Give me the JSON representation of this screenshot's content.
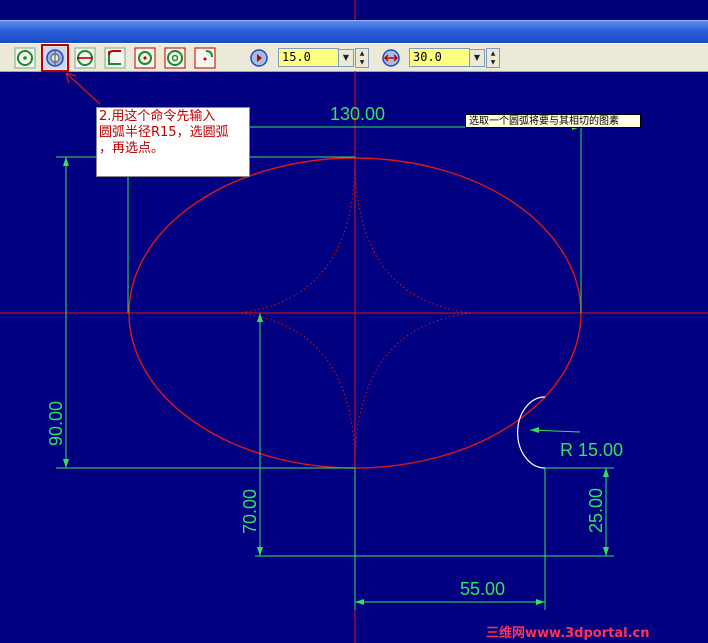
{
  "toolbar": {
    "buttons": [
      {
        "name": "circle-center-tool"
      },
      {
        "name": "arc-tangent-tool",
        "active": true
      },
      {
        "name": "circle-diameter-tool"
      },
      {
        "name": "fillet-tool"
      },
      {
        "name": "arc-point-tool"
      },
      {
        "name": "circle-concentric-tool"
      },
      {
        "name": "corner-arc-tool"
      }
    ],
    "field1": {
      "value": "15.0"
    },
    "field2": {
      "value": "30.0"
    }
  },
  "annotation": {
    "text": "2.用这个命令先输入\n圆弧半径R15，选圆弧\n，再选点。"
  },
  "tooltip": {
    "text": "选取一个圆弧将要与其相切的图素"
  },
  "dimensions": {
    "top_width": "130.00",
    "left_height": "90.00",
    "inner_height": "70.00",
    "radius": "R 15.00",
    "right_height": "25.00",
    "bottom_width": "55.00"
  },
  "watermark": "三维网www.3dportal.cn",
  "colors": {
    "background": "#000080",
    "geometry": "#e01818",
    "dimension": "#33e35a",
    "note_text": "#c00000"
  }
}
